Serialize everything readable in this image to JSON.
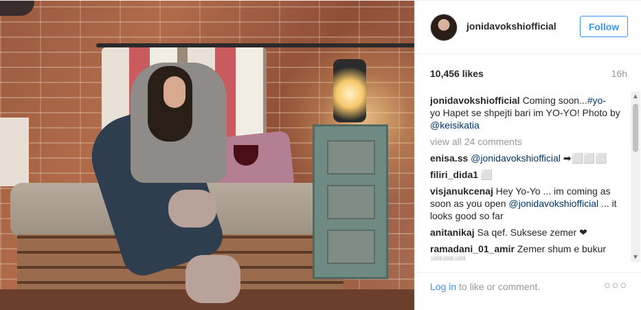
{
  "post": {
    "header": {
      "username": "jonidavokshiofficial",
      "follow_label": "Follow",
      "avatar_icon": "profile-avatar-icon"
    },
    "stats": {
      "likes": "10,456 likes",
      "time_ago": "16h"
    },
    "caption": {
      "username": "jonidavokshiofficial",
      "text_1": " Coming soon...",
      "hashtag": "#yo-",
      "text_2": "yo Hapet se shpejti bari im YO-YO! Photo by ",
      "mention": "@keisikatia"
    },
    "view_all_comments": "view all 24 comments",
    "comments": [
      {
        "user": "enisa.ss",
        "mention": "@jonidavokshiofficial",
        "text": " ➡⬜⬜⬜"
      },
      {
        "user": "filiri_dida1",
        "text": " ⬜"
      },
      {
        "user": "visjanukcenaj",
        "text_1": " Hey Yo-Yo ... im coming as soon as you open ",
        "mention": "@jonidavokshiofficial",
        "text_2": " ... it looks good so far"
      },
      {
        "user": "anitanikaj",
        "text": " Sa qef. Suksese zemer ❤"
      },
      {
        "user": "ramadani_01_amir",
        "text": " Zemer shum e bukur ⬜⬜⬜"
      }
    ],
    "footer": {
      "login_label": "Log in",
      "login_suffix": " to like or comment.",
      "more_icon": "ellipsis-icon",
      "more_glyph": "○○○"
    },
    "scrollbar": {
      "up_glyph": "▲",
      "down_glyph": "▼"
    }
  }
}
